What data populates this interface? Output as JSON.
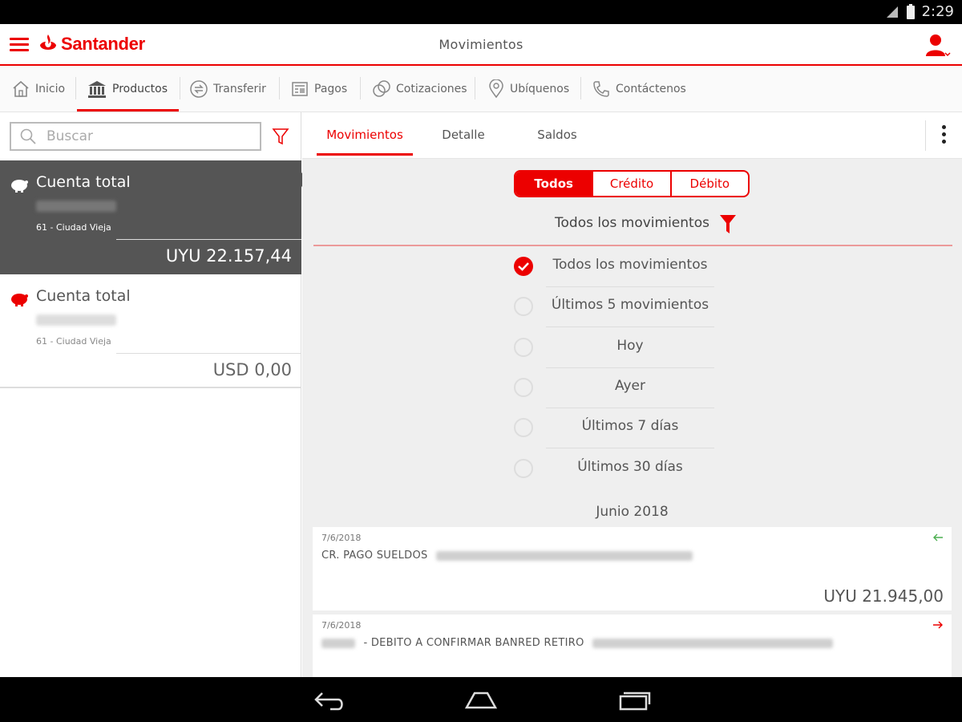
{
  "status_bar": {
    "time": "2:29"
  },
  "app_bar": {
    "brand": "Santander",
    "title": "Movimientos"
  },
  "nav": {
    "items": [
      {
        "label": "Inicio",
        "icon": "home-icon"
      },
      {
        "label": "Productos",
        "icon": "bank-icon",
        "active": true
      },
      {
        "label": "Transferir",
        "icon": "transfer-icon"
      },
      {
        "label": "Pagos",
        "icon": "payments-icon"
      },
      {
        "label": "Cotizaciones",
        "icon": "exchange-icon"
      },
      {
        "label": "Ubíquenos",
        "icon": "location-pin-icon"
      },
      {
        "label": "Contáctenos",
        "icon": "phone-icon"
      }
    ]
  },
  "search": {
    "placeholder": "Buscar",
    "value": ""
  },
  "accounts": [
    {
      "name": "Cuenta total",
      "branch": "61 - Ciudad Vieja",
      "balance": "UYU 22.157,44",
      "selected": true
    },
    {
      "name": "Cuenta total",
      "branch": "61 - Ciudad Vieja",
      "balance": "USD 0,00",
      "selected": false
    }
  ],
  "tabs": [
    {
      "label": "Movimientos",
      "active": true
    },
    {
      "label": "Detalle",
      "active": false
    },
    {
      "label": "Saldos",
      "active": false
    }
  ],
  "segments": [
    {
      "label": "Todos",
      "active": true
    },
    {
      "label": "Crédito",
      "active": false
    },
    {
      "label": "Débito",
      "active": false
    }
  ],
  "filter": {
    "title": "Todos los movimientos",
    "options": [
      {
        "label": "Todos los movimientos",
        "checked": true
      },
      {
        "label": "Últimos 5 movimientos",
        "checked": false
      },
      {
        "label": "Hoy",
        "checked": false
      },
      {
        "label": "Ayer",
        "checked": false
      },
      {
        "label": "Últimos 7 días",
        "checked": false
      },
      {
        "label": "Últimos 30 días",
        "checked": false
      }
    ]
  },
  "movements": {
    "month": "Junio 2018",
    "items": [
      {
        "date": "7/6/2018",
        "description": "CR. PAGO SUELDOS",
        "amount": "UYU 21.945,00",
        "direction": "in"
      },
      {
        "date": "7/6/2018",
        "description": "- DEBITO A CONFIRMAR BANRED RETIRO",
        "amount": "",
        "direction": "out"
      }
    ]
  },
  "colors": {
    "brand_red": "#ec0000",
    "selected_account_bg": "#555555",
    "credit_arrow": "#4caf50"
  }
}
